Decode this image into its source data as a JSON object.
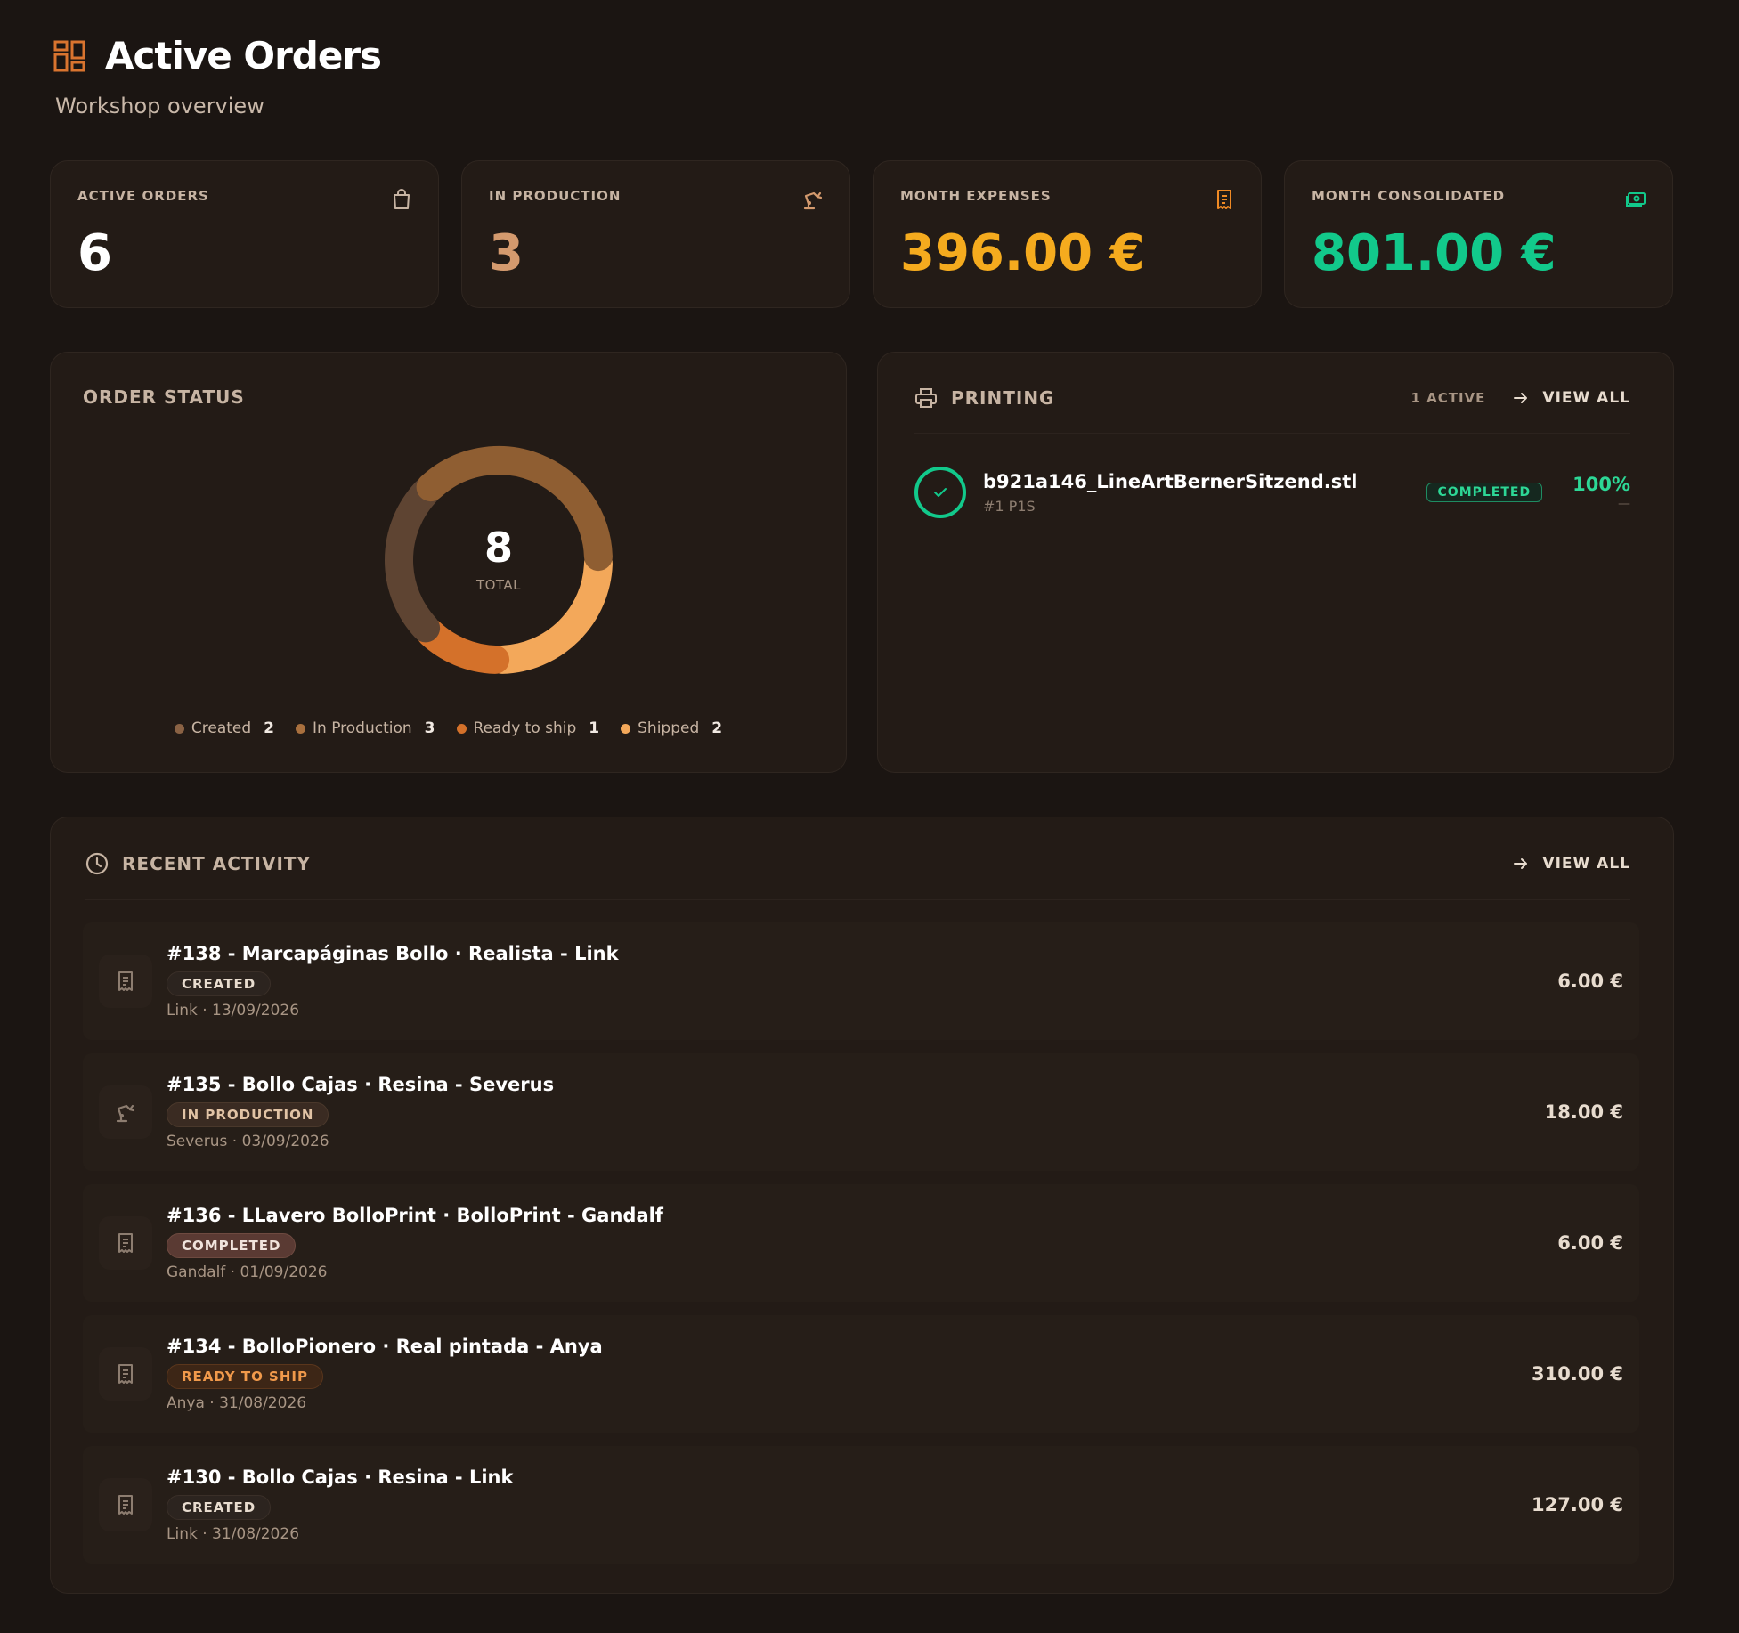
{
  "header": {
    "title": "Active Orders",
    "subtitle": "Workshop overview",
    "icon": "dashboard-icon"
  },
  "stats": [
    {
      "label": "ACTIVE ORDERS",
      "value": "6",
      "color": "#ffffff",
      "icon": "shopping-bag-icon"
    },
    {
      "label": "IN PRODUCTION",
      "value": "3",
      "color": "#d49a6e",
      "icon": "robotic-arm-icon"
    },
    {
      "label": "MONTH EXPENSES",
      "value": "396.00 €",
      "color": "#f5ab1e",
      "icon": "receipt-icon"
    },
    {
      "label": "MONTH CONSOLIDATED",
      "value": "801.00 €",
      "color": "#12c98b",
      "icon": "banknote-icon"
    }
  ],
  "order_status": {
    "title": "ORDER STATUS",
    "total": "8",
    "total_label": "TOTAL"
  },
  "chart_data": {
    "type": "pie",
    "categories": [
      "Created",
      "In Production",
      "Ready to ship",
      "Shipped"
    ],
    "values": [
      2,
      3,
      1,
      2
    ],
    "colors": [
      "#5e4432",
      "#8f5e32",
      "#d4712a",
      "#f3a85a"
    ],
    "legend": "bottom"
  },
  "printing": {
    "title": "PRINTING",
    "active_count": "1 ACTIVE",
    "view_all": "VIEW ALL",
    "jobs": [
      {
        "file": "b921a146_LineArtBernerSitzend.stl",
        "sub": "#1 P1S",
        "status": "COMPLETED",
        "progress": "100%",
        "eta": "—"
      }
    ]
  },
  "activity": {
    "title": "RECENT ACTIVITY",
    "view_all": "VIEW ALL",
    "rows": [
      {
        "title": "#138 - Marcapáginas Bollo · Realista - Link",
        "status": "CREATED",
        "meta": "Link · 13/09/2026",
        "amount": "6.00 €",
        "icon": "receipt-icon"
      },
      {
        "title": "#135 - Bollo Cajas · Resina - Severus",
        "status": "IN PRODUCTION",
        "meta": "Severus · 03/09/2026",
        "amount": "18.00 €",
        "icon": "robotic-arm-icon"
      },
      {
        "title": "#136 - LLavero BolloPrint · BolloPrint - Gandalf",
        "status": "COMPLETED",
        "meta": "Gandalf · 01/09/2026",
        "amount": "6.00 €",
        "icon": "receipt-icon"
      },
      {
        "title": "#134 - BolloPionero · Real pintada - Anya",
        "status": "READY TO SHIP",
        "meta": "Anya · 31/08/2026",
        "amount": "310.00 €",
        "icon": "receipt-icon"
      },
      {
        "title": "#130 - Bollo Cajas · Resina - Link",
        "status": "CREATED",
        "meta": "Link · 31/08/2026",
        "amount": "127.00 €",
        "icon": "receipt-icon"
      }
    ]
  }
}
